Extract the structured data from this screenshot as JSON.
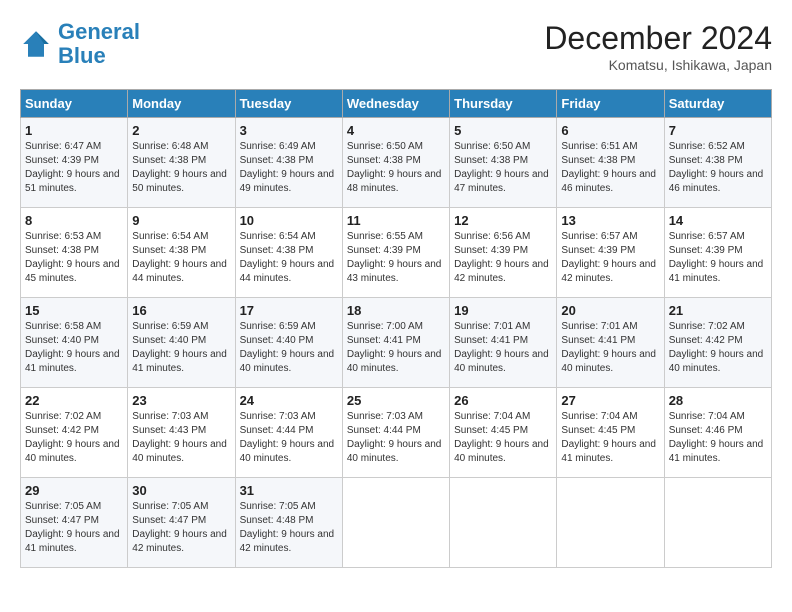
{
  "logo": {
    "line1": "General",
    "line2": "Blue"
  },
  "title": "December 2024",
  "subtitle": "Komatsu, Ishikawa, Japan",
  "days_of_week": [
    "Sunday",
    "Monday",
    "Tuesday",
    "Wednesday",
    "Thursday",
    "Friday",
    "Saturday"
  ],
  "weeks": [
    [
      {
        "day": "1",
        "sunrise": "6:47 AM",
        "sunset": "4:39 PM",
        "daylight": "9 hours and 51 minutes."
      },
      {
        "day": "2",
        "sunrise": "6:48 AM",
        "sunset": "4:38 PM",
        "daylight": "9 hours and 50 minutes."
      },
      {
        "day": "3",
        "sunrise": "6:49 AM",
        "sunset": "4:38 PM",
        "daylight": "9 hours and 49 minutes."
      },
      {
        "day": "4",
        "sunrise": "6:50 AM",
        "sunset": "4:38 PM",
        "daylight": "9 hours and 48 minutes."
      },
      {
        "day": "5",
        "sunrise": "6:50 AM",
        "sunset": "4:38 PM",
        "daylight": "9 hours and 47 minutes."
      },
      {
        "day": "6",
        "sunrise": "6:51 AM",
        "sunset": "4:38 PM",
        "daylight": "9 hours and 46 minutes."
      },
      {
        "day": "7",
        "sunrise": "6:52 AM",
        "sunset": "4:38 PM",
        "daylight": "9 hours and 46 minutes."
      }
    ],
    [
      {
        "day": "8",
        "sunrise": "6:53 AM",
        "sunset": "4:38 PM",
        "daylight": "9 hours and 45 minutes."
      },
      {
        "day": "9",
        "sunrise": "6:54 AM",
        "sunset": "4:38 PM",
        "daylight": "9 hours and 44 minutes."
      },
      {
        "day": "10",
        "sunrise": "6:54 AM",
        "sunset": "4:38 PM",
        "daylight": "9 hours and 44 minutes."
      },
      {
        "day": "11",
        "sunrise": "6:55 AM",
        "sunset": "4:39 PM",
        "daylight": "9 hours and 43 minutes."
      },
      {
        "day": "12",
        "sunrise": "6:56 AM",
        "sunset": "4:39 PM",
        "daylight": "9 hours and 42 minutes."
      },
      {
        "day": "13",
        "sunrise": "6:57 AM",
        "sunset": "4:39 PM",
        "daylight": "9 hours and 42 minutes."
      },
      {
        "day": "14",
        "sunrise": "6:57 AM",
        "sunset": "4:39 PM",
        "daylight": "9 hours and 41 minutes."
      }
    ],
    [
      {
        "day": "15",
        "sunrise": "6:58 AM",
        "sunset": "4:40 PM",
        "daylight": "9 hours and 41 minutes."
      },
      {
        "day": "16",
        "sunrise": "6:59 AM",
        "sunset": "4:40 PM",
        "daylight": "9 hours and 41 minutes."
      },
      {
        "day": "17",
        "sunrise": "6:59 AM",
        "sunset": "4:40 PM",
        "daylight": "9 hours and 40 minutes."
      },
      {
        "day": "18",
        "sunrise": "7:00 AM",
        "sunset": "4:41 PM",
        "daylight": "9 hours and 40 minutes."
      },
      {
        "day": "19",
        "sunrise": "7:01 AM",
        "sunset": "4:41 PM",
        "daylight": "9 hours and 40 minutes."
      },
      {
        "day": "20",
        "sunrise": "7:01 AM",
        "sunset": "4:41 PM",
        "daylight": "9 hours and 40 minutes."
      },
      {
        "day": "21",
        "sunrise": "7:02 AM",
        "sunset": "4:42 PM",
        "daylight": "9 hours and 40 minutes."
      }
    ],
    [
      {
        "day": "22",
        "sunrise": "7:02 AM",
        "sunset": "4:42 PM",
        "daylight": "9 hours and 40 minutes."
      },
      {
        "day": "23",
        "sunrise": "7:03 AM",
        "sunset": "4:43 PM",
        "daylight": "9 hours and 40 minutes."
      },
      {
        "day": "24",
        "sunrise": "7:03 AM",
        "sunset": "4:44 PM",
        "daylight": "9 hours and 40 minutes."
      },
      {
        "day": "25",
        "sunrise": "7:03 AM",
        "sunset": "4:44 PM",
        "daylight": "9 hours and 40 minutes."
      },
      {
        "day": "26",
        "sunrise": "7:04 AM",
        "sunset": "4:45 PM",
        "daylight": "9 hours and 40 minutes."
      },
      {
        "day": "27",
        "sunrise": "7:04 AM",
        "sunset": "4:45 PM",
        "daylight": "9 hours and 41 minutes."
      },
      {
        "day": "28",
        "sunrise": "7:04 AM",
        "sunset": "4:46 PM",
        "daylight": "9 hours and 41 minutes."
      }
    ],
    [
      {
        "day": "29",
        "sunrise": "7:05 AM",
        "sunset": "4:47 PM",
        "daylight": "9 hours and 41 minutes."
      },
      {
        "day": "30",
        "sunrise": "7:05 AM",
        "sunset": "4:47 PM",
        "daylight": "9 hours and 42 minutes."
      },
      {
        "day": "31",
        "sunrise": "7:05 AM",
        "sunset": "4:48 PM",
        "daylight": "9 hours and 42 minutes."
      },
      null,
      null,
      null,
      null
    ]
  ]
}
